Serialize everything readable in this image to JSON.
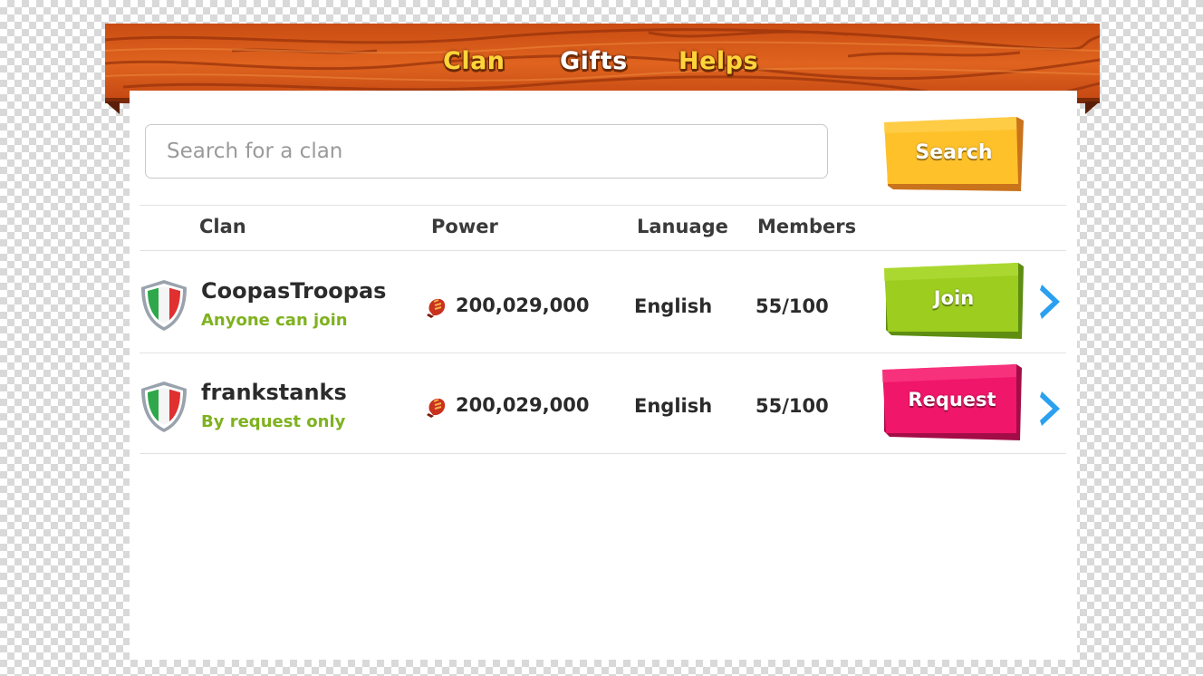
{
  "tabs": [
    {
      "label": "Clan",
      "color": "#ffd43a"
    },
    {
      "label": "Gifts",
      "color": "#ffffff"
    },
    {
      "label": "Helps",
      "color": "#ffd43a"
    }
  ],
  "search": {
    "placeholder": "Search for a clan",
    "value": "",
    "button_label": "Search"
  },
  "table": {
    "headers": {
      "clan": "Clan",
      "power": "Power",
      "language": "Lanuage",
      "members": "Members"
    },
    "rows": [
      {
        "name": "CoopasTroopas",
        "status": "Anyone can join",
        "power": "200,029,000",
        "language": "English",
        "members": "55/100",
        "action": "Join",
        "action_color": "#9ccd1f",
        "flag_icon": "italy-shield-icon"
      },
      {
        "name": "frankstanks",
        "status": "By request only",
        "power": "200,029,000",
        "language": "English",
        "members": "55/100",
        "action": "Request",
        "action_color": "#f0166a",
        "flag_icon": "italy-shield-icon"
      }
    ]
  },
  "colors": {
    "wood": "#d4551a",
    "status_green": "#7fb21f",
    "search_button": "#ffc12a",
    "chevron": "#2aa0f0"
  }
}
